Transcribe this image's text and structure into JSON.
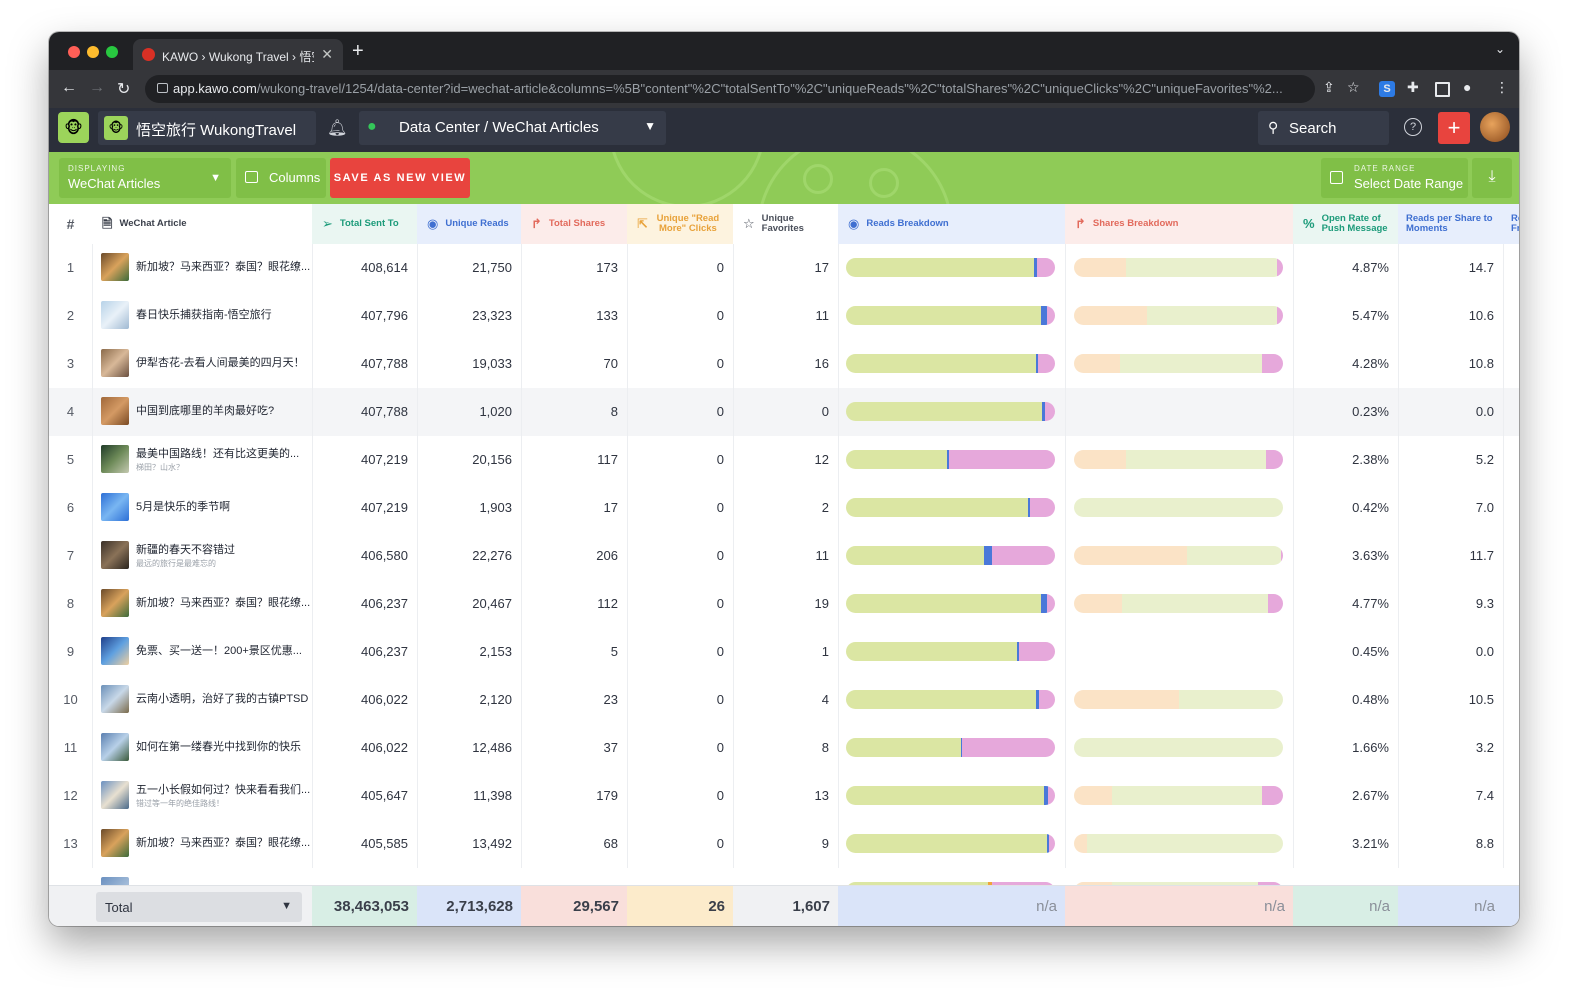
{
  "browser": {
    "tab_title": "KAWO › Wukong Travel › 悟空旅",
    "url_host": "app.kawo.com",
    "url_path": "/wukong-travel/1254/data-center?id=wechat-article&columns=%5B\"content\"%2C\"totalSentTo\"%2C\"uniqueReads\"%2C\"totalShares\"%2C\"uniqueClicks\"%2C\"uniqueFavorites\"%2..."
  },
  "header": {
    "brand_name": "悟空旅行 WukongTravel",
    "breadcrumb": "Data Center / WeChat Articles",
    "search_label": "Search"
  },
  "toolbar": {
    "displaying_label": "DISPLAYING",
    "displaying_value": "WeChat Articles",
    "columns_label": "Columns",
    "save_view_label": "SAVE AS NEW VIEW",
    "date_range_label": "DATE RANGE",
    "date_range_value": "Select Date Range"
  },
  "columns": {
    "index": "#",
    "article": "WeChat Article",
    "total_sent": "Total Sent To",
    "unique_reads": "Unique Reads",
    "total_shares": "Total Shares",
    "read_more": "Unique \"Read More\" Clicks",
    "favorites": "Unique Favorites",
    "reads_breakdown": "Reads Breakdown",
    "shares_breakdown": "Shares Breakdown",
    "open_rate": "Open Rate of Push Message",
    "reads_per_share": "Reads per Share to Moments",
    "cut_off": "Re Fr"
  },
  "colors": {
    "accent_green": "#8fcb57",
    "accent_red": "#e8443e",
    "reads_blue": "#3f6fd1",
    "shares_red": "#e26a5c",
    "read_more_orange": "#e8a23a",
    "bar_green": "#dbe6a3",
    "bar_pink": "#e6a8db",
    "bar_blue": "#4a78d9",
    "bar_orange": "#f0a53a",
    "bar_peach": "#fbe3c6",
    "bar_lightgreen": "#e9f0cd"
  },
  "rows": [
    {
      "index": "1",
      "title": "新加坡？马来西亚？泰国？眼花缭...",
      "subtitle": "",
      "total_sent": "408,614",
      "unique_reads": "21,750",
      "total_shares": "173",
      "read_more": "0",
      "favorites": "17",
      "open_rate": "4.87%",
      "reads_per_share": "14.7",
      "reads_breakdown": [
        0.9,
        0.015,
        0.085
      ],
      "shares_breakdown": [
        0.25,
        0.72,
        0.03
      ]
    },
    {
      "index": "2",
      "title": "春日快乐捕获指南-悟空旅行",
      "subtitle": "",
      "total_sent": "407,796",
      "unique_reads": "23,323",
      "total_shares": "133",
      "read_more": "0",
      "favorites": "11",
      "open_rate": "5.47%",
      "reads_per_share": "10.6",
      "reads_breakdown": [
        0.935,
        0.025,
        0.04
      ],
      "shares_breakdown": [
        0.35,
        0.62,
        0.03
      ]
    },
    {
      "index": "3",
      "title": "伊犁杏花-去看人间最美的四月天！",
      "subtitle": "",
      "total_sent": "407,788",
      "unique_reads": "19,033",
      "total_shares": "70",
      "read_more": "0",
      "favorites": "16",
      "open_rate": "4.28%",
      "reads_per_share": "10.8",
      "reads_breakdown": [
        0.91,
        0.01,
        0.08
      ],
      "shares_breakdown": [
        0.22,
        0.68,
        0.1
      ]
    },
    {
      "index": "4",
      "title": "中国到底哪里的羊肉最好吃?",
      "subtitle": "",
      "total_sent": "407,788",
      "unique_reads": "1,020",
      "total_shares": "8",
      "read_more": "0",
      "favorites": "0",
      "open_rate": "0.23%",
      "reads_per_share": "0.0",
      "reads_breakdown": [
        0.94,
        0.01,
        0.05
      ],
      "shares_breakdown": [
        0,
        0,
        0
      ]
    },
    {
      "index": "5",
      "title": "最美中国路线！还有比这更美的...",
      "subtitle": "梯田？山水？",
      "total_sent": "407,219",
      "unique_reads": "20,156",
      "total_shares": "117",
      "read_more": "0",
      "favorites": "12",
      "open_rate": "2.38%",
      "reads_per_share": "5.2",
      "reads_breakdown": [
        0.485,
        0.01,
        0.505
      ],
      "shares_breakdown": [
        0.25,
        0.67,
        0.08
      ]
    },
    {
      "index": "6",
      "title": "5月是快乐的季节啊",
      "subtitle": "",
      "total_sent": "407,219",
      "unique_reads": "1,903",
      "total_shares": "17",
      "read_more": "0",
      "favorites": "2",
      "open_rate": "0.42%",
      "reads_per_share": "7.0",
      "reads_breakdown": [
        0.87,
        0.01,
        0.12
      ],
      "shares_breakdown": [
        0,
        1.0,
        0
      ]
    },
    {
      "index": "7",
      "title": "新疆的春天不容错过",
      "subtitle": "最远的旅行是最难忘的",
      "total_sent": "406,580",
      "unique_reads": "22,276",
      "total_shares": "206",
      "read_more": "0",
      "favorites": "11",
      "open_rate": "3.63%",
      "reads_per_share": "11.7",
      "reads_breakdown": [
        0.66,
        0.04,
        0.3
      ],
      "shares_breakdown": [
        0.54,
        0.45,
        0.01
      ]
    },
    {
      "index": "8",
      "title": "新加坡？马来西亚？泰国？眼花缭...",
      "subtitle": "",
      "total_sent": "406,237",
      "unique_reads": "20,467",
      "total_shares": "112",
      "read_more": "0",
      "favorites": "19",
      "open_rate": "4.77%",
      "reads_per_share": "9.3",
      "reads_breakdown": [
        0.935,
        0.025,
        0.04
      ],
      "shares_breakdown": [
        0.23,
        0.7,
        0.07
      ]
    },
    {
      "index": "9",
      "title": "免票、买一送一！200+景区优惠...",
      "subtitle": "",
      "total_sent": "406,237",
      "unique_reads": "2,153",
      "total_shares": "5",
      "read_more": "0",
      "favorites": "1",
      "open_rate": "0.45%",
      "reads_per_share": "0.0",
      "reads_breakdown": [
        0.82,
        0.01,
        0.17
      ],
      "shares_breakdown": [
        0,
        0,
        0
      ]
    },
    {
      "index": "10",
      "title": "云南小透明，治好了我的古镇PTSD",
      "subtitle": "",
      "total_sent": "406,022",
      "unique_reads": "2,120",
      "total_shares": "23",
      "read_more": "0",
      "favorites": "4",
      "open_rate": "0.48%",
      "reads_per_share": "10.5",
      "reads_breakdown": [
        0.91,
        0.015,
        0.075
      ],
      "shares_breakdown": [
        0.5,
        0.5,
        0
      ]
    },
    {
      "index": "11",
      "title": "如何在第一缕春光中找到你的快乐",
      "subtitle": "",
      "total_sent": "406,022",
      "unique_reads": "12,486",
      "total_shares": "37",
      "read_more": "0",
      "favorites": "8",
      "open_rate": "1.66%",
      "reads_per_share": "3.2",
      "reads_breakdown": [
        0.55,
        0.005,
        0.445
      ],
      "shares_breakdown": [
        0,
        1.0,
        0
      ]
    },
    {
      "index": "12",
      "title": "五一小长假如何过？快来看看我们...",
      "subtitle": "错过等一年的绝佳路线！",
      "total_sent": "405,647",
      "unique_reads": "11,398",
      "total_shares": "179",
      "read_more": "0",
      "favorites": "13",
      "open_rate": "2.67%",
      "reads_per_share": "7.4",
      "reads_breakdown": [
        0.945,
        0.02,
        0.035
      ],
      "shares_breakdown": [
        0.18,
        0.72,
        0.1
      ]
    },
    {
      "index": "13",
      "title": "新加坡？马来西亚？泰国？眼花缭...",
      "subtitle": "",
      "total_sent": "405,585",
      "unique_reads": "13,492",
      "total_shares": "68",
      "read_more": "0",
      "favorites": "9",
      "open_rate": "3.21%",
      "reads_per_share": "8.8",
      "reads_breakdown": [
        0.96,
        0.01,
        0.03
      ],
      "shares_breakdown": [
        0.06,
        0.94,
        0
      ]
    }
  ],
  "totals": {
    "selector": "Total",
    "total_sent": "38,463,053",
    "unique_reads": "2,713,628",
    "total_shares": "29,567",
    "read_more": "26",
    "favorites": "1,607",
    "reads_breakdown": "n/a",
    "shares_breakdown": "n/a",
    "open_rate": "n/a",
    "reads_per_share": "n/a"
  }
}
